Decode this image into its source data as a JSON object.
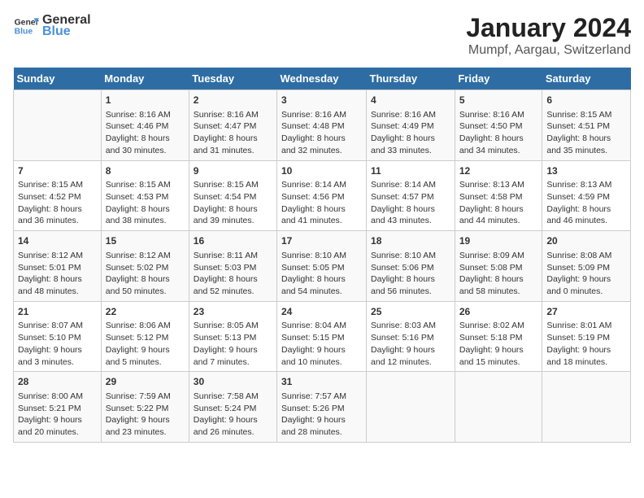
{
  "header": {
    "logo_general": "General",
    "logo_blue": "Blue",
    "title": "January 2024",
    "subtitle": "Mumpf, Aargau, Switzerland"
  },
  "columns": [
    "Sunday",
    "Monday",
    "Tuesday",
    "Wednesday",
    "Thursday",
    "Friday",
    "Saturday"
  ],
  "weeks": [
    [
      {
        "day": "",
        "info": ""
      },
      {
        "day": "1",
        "info": "Sunrise: 8:16 AM\nSunset: 4:46 PM\nDaylight: 8 hours\nand 30 minutes."
      },
      {
        "day": "2",
        "info": "Sunrise: 8:16 AM\nSunset: 4:47 PM\nDaylight: 8 hours\nand 31 minutes."
      },
      {
        "day": "3",
        "info": "Sunrise: 8:16 AM\nSunset: 4:48 PM\nDaylight: 8 hours\nand 32 minutes."
      },
      {
        "day": "4",
        "info": "Sunrise: 8:16 AM\nSunset: 4:49 PM\nDaylight: 8 hours\nand 33 minutes."
      },
      {
        "day": "5",
        "info": "Sunrise: 8:16 AM\nSunset: 4:50 PM\nDaylight: 8 hours\nand 34 minutes."
      },
      {
        "day": "6",
        "info": "Sunrise: 8:15 AM\nSunset: 4:51 PM\nDaylight: 8 hours\nand 35 minutes."
      }
    ],
    [
      {
        "day": "7",
        "info": "Sunrise: 8:15 AM\nSunset: 4:52 PM\nDaylight: 8 hours\nand 36 minutes."
      },
      {
        "day": "8",
        "info": "Sunrise: 8:15 AM\nSunset: 4:53 PM\nDaylight: 8 hours\nand 38 minutes."
      },
      {
        "day": "9",
        "info": "Sunrise: 8:15 AM\nSunset: 4:54 PM\nDaylight: 8 hours\nand 39 minutes."
      },
      {
        "day": "10",
        "info": "Sunrise: 8:14 AM\nSunset: 4:56 PM\nDaylight: 8 hours\nand 41 minutes."
      },
      {
        "day": "11",
        "info": "Sunrise: 8:14 AM\nSunset: 4:57 PM\nDaylight: 8 hours\nand 43 minutes."
      },
      {
        "day": "12",
        "info": "Sunrise: 8:13 AM\nSunset: 4:58 PM\nDaylight: 8 hours\nand 44 minutes."
      },
      {
        "day": "13",
        "info": "Sunrise: 8:13 AM\nSunset: 4:59 PM\nDaylight: 8 hours\nand 46 minutes."
      }
    ],
    [
      {
        "day": "14",
        "info": "Sunrise: 8:12 AM\nSunset: 5:01 PM\nDaylight: 8 hours\nand 48 minutes."
      },
      {
        "day": "15",
        "info": "Sunrise: 8:12 AM\nSunset: 5:02 PM\nDaylight: 8 hours\nand 50 minutes."
      },
      {
        "day": "16",
        "info": "Sunrise: 8:11 AM\nSunset: 5:03 PM\nDaylight: 8 hours\nand 52 minutes."
      },
      {
        "day": "17",
        "info": "Sunrise: 8:10 AM\nSunset: 5:05 PM\nDaylight: 8 hours\nand 54 minutes."
      },
      {
        "day": "18",
        "info": "Sunrise: 8:10 AM\nSunset: 5:06 PM\nDaylight: 8 hours\nand 56 minutes."
      },
      {
        "day": "19",
        "info": "Sunrise: 8:09 AM\nSunset: 5:08 PM\nDaylight: 8 hours\nand 58 minutes."
      },
      {
        "day": "20",
        "info": "Sunrise: 8:08 AM\nSunset: 5:09 PM\nDaylight: 9 hours\nand 0 minutes."
      }
    ],
    [
      {
        "day": "21",
        "info": "Sunrise: 8:07 AM\nSunset: 5:10 PM\nDaylight: 9 hours\nand 3 minutes."
      },
      {
        "day": "22",
        "info": "Sunrise: 8:06 AM\nSunset: 5:12 PM\nDaylight: 9 hours\nand 5 minutes."
      },
      {
        "day": "23",
        "info": "Sunrise: 8:05 AM\nSunset: 5:13 PM\nDaylight: 9 hours\nand 7 minutes."
      },
      {
        "day": "24",
        "info": "Sunrise: 8:04 AM\nSunset: 5:15 PM\nDaylight: 9 hours\nand 10 minutes."
      },
      {
        "day": "25",
        "info": "Sunrise: 8:03 AM\nSunset: 5:16 PM\nDaylight: 9 hours\nand 12 minutes."
      },
      {
        "day": "26",
        "info": "Sunrise: 8:02 AM\nSunset: 5:18 PM\nDaylight: 9 hours\nand 15 minutes."
      },
      {
        "day": "27",
        "info": "Sunrise: 8:01 AM\nSunset: 5:19 PM\nDaylight: 9 hours\nand 18 minutes."
      }
    ],
    [
      {
        "day": "28",
        "info": "Sunrise: 8:00 AM\nSunset: 5:21 PM\nDaylight: 9 hours\nand 20 minutes."
      },
      {
        "day": "29",
        "info": "Sunrise: 7:59 AM\nSunset: 5:22 PM\nDaylight: 9 hours\nand 23 minutes."
      },
      {
        "day": "30",
        "info": "Sunrise: 7:58 AM\nSunset: 5:24 PM\nDaylight: 9 hours\nand 26 minutes."
      },
      {
        "day": "31",
        "info": "Sunrise: 7:57 AM\nSunset: 5:26 PM\nDaylight: 9 hours\nand 28 minutes."
      },
      {
        "day": "",
        "info": ""
      },
      {
        "day": "",
        "info": ""
      },
      {
        "day": "",
        "info": ""
      }
    ]
  ]
}
